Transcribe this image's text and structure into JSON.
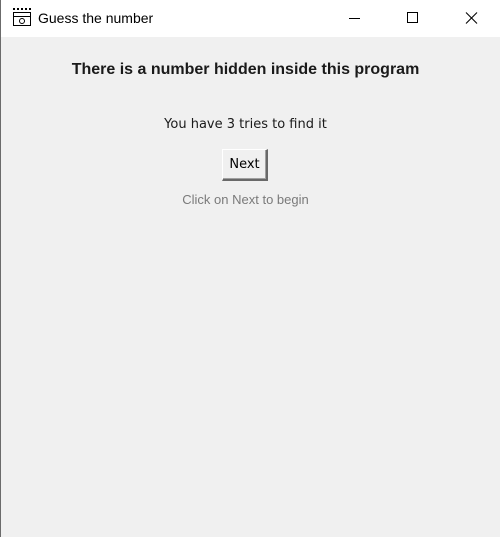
{
  "window": {
    "title": "Guess the number",
    "icon": "tkinter-feather-icon"
  },
  "controls": {
    "minimize": "minimize-icon",
    "maximize": "maximize-icon",
    "close": "close-icon"
  },
  "main": {
    "headline": "There is a number hidden inside this program",
    "tries_text": "You have 3 tries to find it",
    "next_label": "Next",
    "hint": "Click on Next to begin"
  },
  "colors": {
    "background": "#f0f0f0",
    "titlebar": "#ffffff",
    "hint_text": "#7a7a7a"
  }
}
